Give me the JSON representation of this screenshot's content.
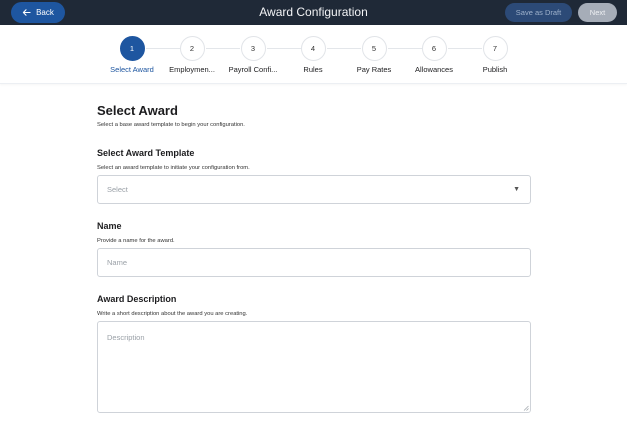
{
  "header": {
    "back_label": "Back",
    "title": "Award Configuration",
    "save_draft_label": "Save as Draft",
    "next_label": "Next"
  },
  "stepper": {
    "steps": [
      {
        "number": "1",
        "label": "Select Award",
        "active": true
      },
      {
        "number": "2",
        "label": "Employmen..."
      },
      {
        "number": "3",
        "label": "Payroll Confi..."
      },
      {
        "number": "4",
        "label": "Rules"
      },
      {
        "number": "5",
        "label": "Pay Rates"
      },
      {
        "number": "6",
        "label": "Allowances"
      },
      {
        "number": "7",
        "label": "Publish"
      }
    ]
  },
  "form": {
    "title": "Select Award",
    "subtitle": "Select a base award template to begin your configuration.",
    "template": {
      "label": "Select Award Template",
      "help": "Select an award template to initiate your configuration from.",
      "placeholder": "Select"
    },
    "name": {
      "label": "Name",
      "help": "Provide a name for the award.",
      "placeholder": "Name"
    },
    "description": {
      "label": "Award Description",
      "help": "Write a short description about the award you are creating.",
      "placeholder": "Description"
    }
  },
  "colors": {
    "accent": "#1e56a0",
    "topbar": "#1f2937"
  }
}
